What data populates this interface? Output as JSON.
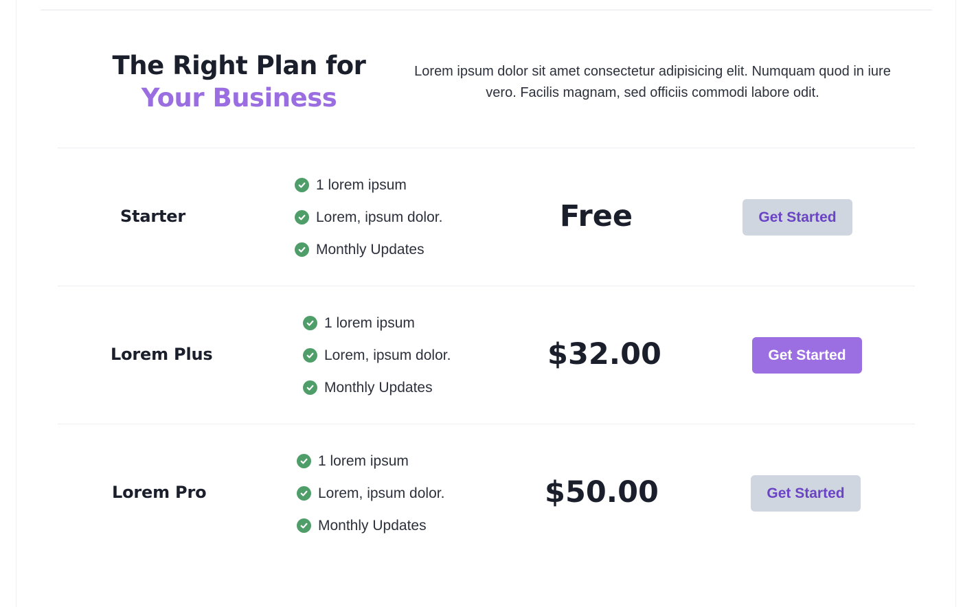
{
  "header": {
    "title_line1": "The Right Plan for",
    "title_line2": "Your Business",
    "description": "Lorem ipsum dolor sit amet consectetur adipisicing elit. Numquam quod in iure vero. Facilis magnam, sed officiis commodi labore odit."
  },
  "plans": [
    {
      "name": "Starter",
      "features": [
        "1 lorem ipsum",
        "Lorem, ipsum dolor.",
        "Monthly Updates"
      ],
      "price": "Free",
      "cta_label": "Get Started",
      "cta_style": "secondary"
    },
    {
      "name": "Lorem Plus",
      "features": [
        "1 lorem ipsum",
        "Lorem, ipsum dolor.",
        "Monthly Updates"
      ],
      "price": "$32.00",
      "cta_label": "Get Started",
      "cta_style": "primary"
    },
    {
      "name": "Lorem Pro",
      "features": [
        "1 lorem ipsum",
        "Lorem, ipsum dolor.",
        "Monthly Updates"
      ],
      "price": "$50.00",
      "cta_label": "Get Started",
      "cta_style": "secondary"
    }
  ],
  "icons": {
    "feature_icon": "check-circle-icon"
  },
  "colors": {
    "accent": "#9b6fe2",
    "heading_accent": "#9a6ee0",
    "check_green": "#4f9e6a",
    "secondary_button_bg": "#cfd6df",
    "secondary_button_text": "#6a44c4"
  }
}
